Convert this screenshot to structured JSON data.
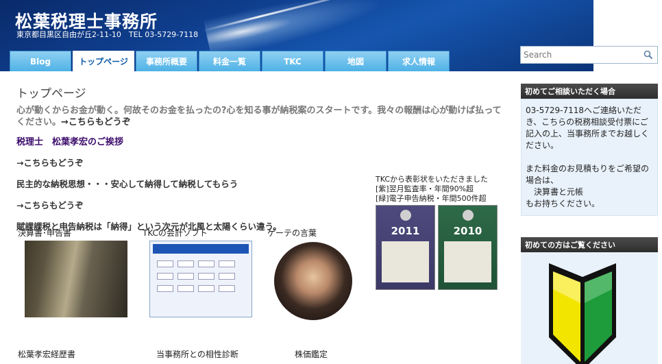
{
  "header": {
    "title": "松葉税理士事務所",
    "address": "東京都目黒区自由が丘2-11-10　TEL 03-5729-7118"
  },
  "nav": {
    "tabs": [
      {
        "label": "Blog"
      },
      {
        "label": "トップページ"
      },
      {
        "label": "事務所概要"
      },
      {
        "label": "料金一覧"
      },
      {
        "label": "TKC"
      },
      {
        "label": "地図"
      },
      {
        "label": "求人情報"
      }
    ],
    "active_index": 1
  },
  "search": {
    "placeholder": "Search"
  },
  "main": {
    "page_title": "トップページ",
    "intro_text": "心が動くからお金が動く。何故そのお金を払ったの?心を知る事が納税案のスタートです。我々の報酬は心が動けば払ってください。",
    "intro_link": "→こちらもどうぞ",
    "greeting": "税理士　松葉孝宏のご挨拶",
    "link1": "→こちらもどうぞ",
    "philosophy": "民主的な納税思想・・・安心して納得して納税してもらう",
    "link2": "→こちらもどうぞ",
    "tax_text": "賦課課税と申告納税は「納得」という次元が北風と太陽くらい違う。",
    "award": {
      "line1": "TKCから表彰状をいただきました",
      "line2": "[紫]翌月監査率・年間90%超",
      "line3": "[緑]電子申告納税・年間500件超",
      "cert1_year": "2011",
      "cert2_year": "2010"
    },
    "thumbnails": [
      {
        "label": "決算書･申告書"
      },
      {
        "label": "TKCの会計ソフト"
      },
      {
        "label": "ゲーテの言葉"
      }
    ],
    "bottom_links": [
      {
        "label": "松葉孝宏経歴書"
      },
      {
        "label": "当事務所との相性診断"
      },
      {
        "label": "株価鑑定"
      }
    ]
  },
  "sidebar": {
    "box1": {
      "heading": "初めてご相談いただく場合",
      "para1": "03-5729-7118へご連絡いただき、こちらの税務相談受付票にご記入の上、当事務所までお越しください。",
      "para2": "また料金のお見積もりをご希望の場合は、",
      "item": "決算書と元帳",
      "para3": "もお持ちください。"
    },
    "box2": {
      "heading": "初めての方はご覧ください"
    }
  },
  "colors": {
    "header_bg": "#0f3f8f",
    "nav_tab": "#4fb2e6",
    "sidebar_head": "#333333",
    "sidebar_body": "#e9f2fb",
    "greeting": "#3a0a6a"
  }
}
